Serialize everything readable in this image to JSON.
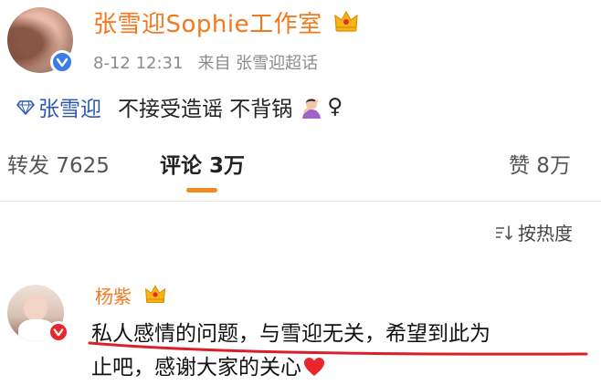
{
  "header": {
    "account_name": "张雪迎Sophie工作室",
    "date": "8-12 12:31",
    "source": "来自 张雪迎超话"
  },
  "post": {
    "tag": "张雪迎",
    "text1": "不接受造谣 不背锅",
    "text2": "♀"
  },
  "actions": {
    "repost": "转发 7625",
    "comments": "评论 3万",
    "likes": "赞 8万",
    "sort": "按热度"
  },
  "comment": {
    "author": "杨紫",
    "line1": "私人感情的问题，与雪迎无关，希望到此为",
    "line2": "止吧，感谢大家的关心"
  },
  "colors": {
    "brand_orange": "#f2791d",
    "tag_blue": "#2a57b7",
    "verified_blue": "#3b7de6",
    "verified_red": "#e8262b",
    "underline_red": "#d9202a",
    "tab_indicator": "#f28a1e",
    "heart": "#e8262b"
  }
}
